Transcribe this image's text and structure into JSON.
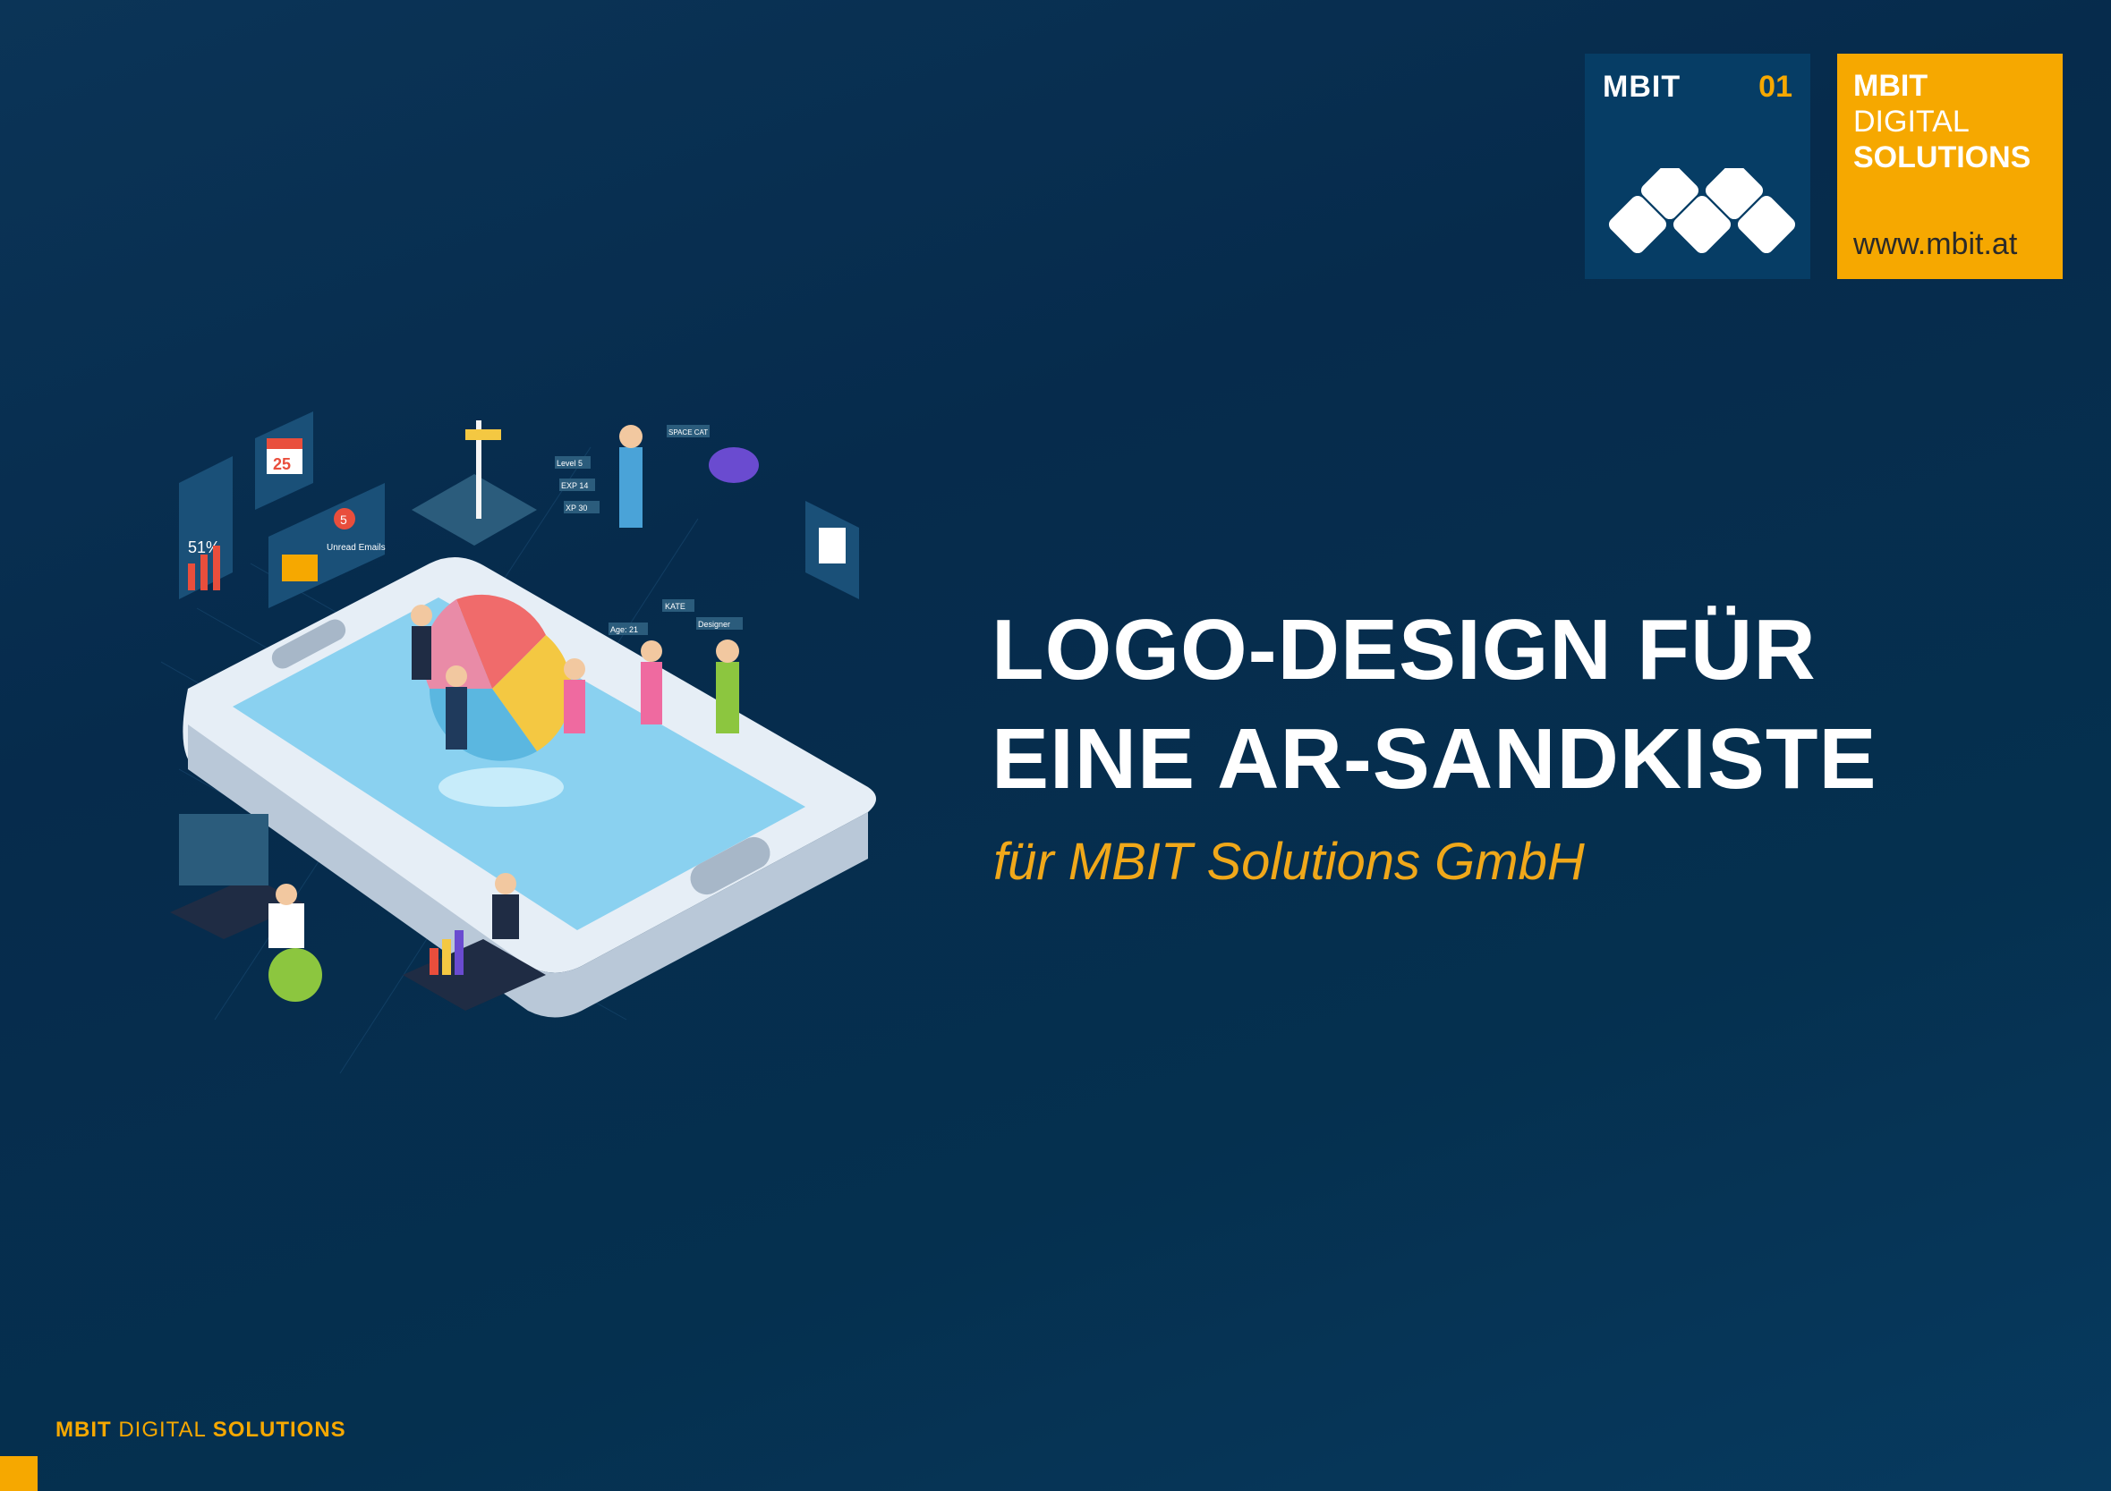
{
  "logo": {
    "brand": "MBIT",
    "number": "01",
    "orange_line1": "MBIT",
    "orange_line2": "DIGITAL",
    "orange_line3": "SOLUTIONS",
    "url": "www.mbit.at"
  },
  "headline": {
    "line1": "LOGO-DESIGN FÜR",
    "line2": "EINE AR-SANDKISTE"
  },
  "subline": "für MBIT Solutions GmbH",
  "illustration": {
    "percent_label": "51%",
    "calendar_day": "25",
    "unread_count": "5",
    "unread_label": "Unread Emails",
    "level_tags": [
      "Level 5",
      "EXP 14",
      "XP 30"
    ],
    "space_cat": "SPACE CAT",
    "profile_tags": [
      "KATE",
      "Age: 21",
      "Designer"
    ]
  },
  "footer": {
    "part1": "MBIT",
    "part2": "DIGITAL",
    "part3": "SOLUTIONS"
  },
  "colors": {
    "accent": "#f6a800",
    "navy": "#063d65",
    "background": "#062b4c"
  }
}
